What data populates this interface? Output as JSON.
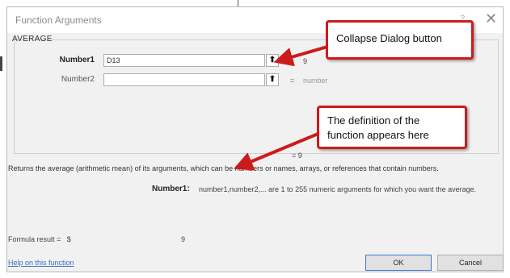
{
  "dialog": {
    "title": "Function Arguments",
    "help_glyph": "?",
    "close_glyph": "✕",
    "function_name": "AVERAGE"
  },
  "args": [
    {
      "label": "Number1",
      "value": "D13",
      "equals": "=",
      "result": "9"
    },
    {
      "label": "Number2",
      "value": "",
      "equals": "=",
      "result": "number"
    }
  ],
  "collapse_glyph": "⬆",
  "result_line": "=  9",
  "description": "Returns the average (arithmetic mean) of its arguments, which can be numbers or names, arrays, or references that contain numbers.",
  "arg_help": {
    "name": "Number1:",
    "text": "number1,number2,... are 1 to 255 numeric arguments for which you want the average."
  },
  "formula": {
    "label": "Formula result =",
    "currency": "$",
    "value": "9"
  },
  "help_link": "Help on this function",
  "buttons": {
    "ok": "OK",
    "cancel": "Cancel"
  },
  "callouts": {
    "collapse": "Collapse Dialog button",
    "definition": "The definition of the function appears here"
  },
  "colors": {
    "callout_border": "#cc1b1b",
    "link": "#3a6fc4"
  }
}
